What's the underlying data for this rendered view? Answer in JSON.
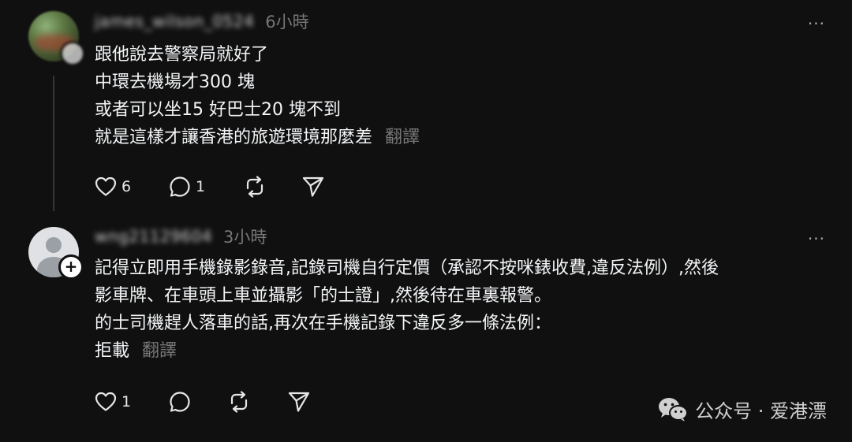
{
  "posts": [
    {
      "username": "james_wilson_0524",
      "time": "6小時",
      "more_label": "···",
      "lines": [
        "跟他說去警察局就好了",
        "中環去機場才300 塊",
        "或者可以坐15 好巴士20 塊不到",
        "就是這樣才讓香港的旅遊環境那麼差"
      ],
      "translate_label": "翻譯",
      "likes": "6",
      "comments": "1"
    },
    {
      "username": "wng21129604",
      "time": "3小時",
      "more_label": "···",
      "lines": [
        "記得立即用手機錄影錄音,記錄司機自行定價（承認不按咪錶收費,違反法例）,然後",
        "影車牌、在車頭上車並攝影「的士證」,然後待在車裏報警。",
        "的士司機趕人落車的話,再次在手機記錄下違反多一條法例：",
        "拒載"
      ],
      "translate_label": "翻譯",
      "likes": "1",
      "comments": ""
    }
  ],
  "watermark": {
    "text": "公众号 · 爱港漂",
    "icon": "wechat-icon"
  },
  "icons": {
    "like": "heart-icon",
    "comment": "comment-icon",
    "repost": "repost-icon",
    "share": "share-icon",
    "follow": "plus-icon"
  },
  "colors": {
    "background": "#101010",
    "text": "#f3f5f7",
    "secondary": "#777777"
  }
}
